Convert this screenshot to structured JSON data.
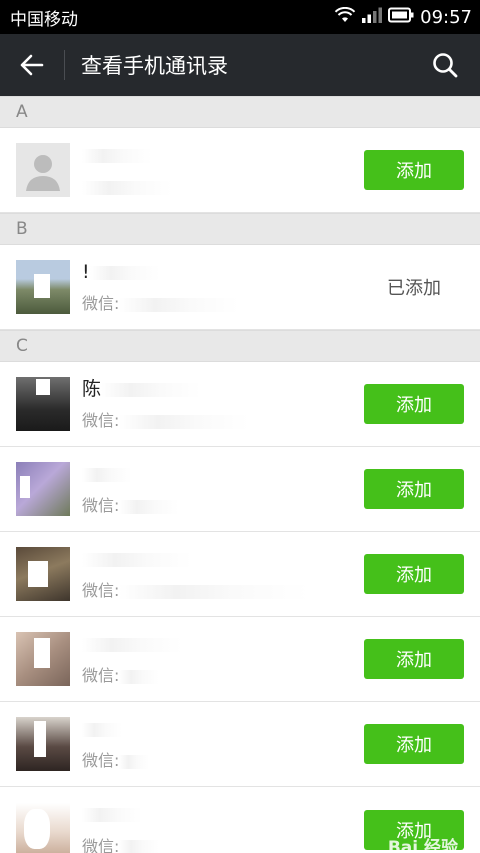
{
  "status_bar": {
    "carrier": "中国移动",
    "time": "09:57"
  },
  "app_bar": {
    "title": "查看手机通讯录"
  },
  "sections": [
    {
      "letter": "A",
      "contacts": [
        {
          "name": "",
          "wechat": "",
          "action": "添加",
          "added": false,
          "avatar_icon": "default-avatar-icon"
        }
      ]
    },
    {
      "letter": "B",
      "contacts": [
        {
          "name": "!",
          "wechat": "微信:",
          "action": "已添加",
          "added": true,
          "avatar_icon": "photo-avatar"
        }
      ]
    },
    {
      "letter": "C",
      "contacts": [
        {
          "name": "陈",
          "wechat": "微信:",
          "action": "添加",
          "added": false,
          "avatar_icon": "photo-avatar"
        },
        {
          "name": "",
          "wechat": "微信:",
          "action": "添加",
          "added": false,
          "avatar_icon": "photo-avatar"
        },
        {
          "name": "",
          "wechat": "微信:",
          "action": "添加",
          "added": false,
          "avatar_icon": "photo-avatar"
        },
        {
          "name": "",
          "wechat": "微信:",
          "action": "添加",
          "added": false,
          "avatar_icon": "photo-avatar"
        },
        {
          "name": "",
          "wechat": "微信:",
          "action": "添加",
          "added": false,
          "avatar_icon": "photo-avatar"
        },
        {
          "name": "",
          "wechat": "微信:",
          "action": "添加",
          "added": false,
          "avatar_icon": "photo-avatar"
        }
      ]
    }
  ],
  "watermark": "Bai 经验",
  "colors": {
    "accent_green": "#45c01a",
    "app_bar": "#26292d",
    "section_bg": "#e8e8e8"
  }
}
